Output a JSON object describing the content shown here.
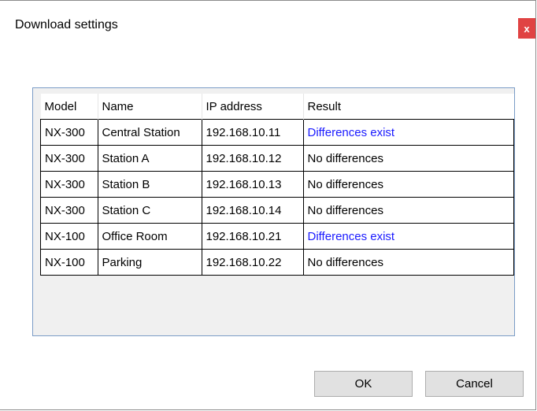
{
  "window": {
    "title": "Download settings",
    "close_label": "x"
  },
  "table": {
    "headers": [
      "Model",
      "Name",
      "IP address",
      "Result"
    ],
    "rows": [
      [
        "NX-300",
        "Central Station",
        "192.168.10.11",
        "Differences exist"
      ],
      [
        "NX-300",
        "Station A",
        "192.168.10.12",
        "No differences"
      ],
      [
        "NX-300",
        "Station B",
        "192.168.10.13",
        "No differences"
      ],
      [
        "NX-300",
        "Station C",
        "192.168.10.14",
        "No differences"
      ],
      [
        "NX-100",
        "Office Room",
        "192.168.10.21",
        "Differences exist"
      ],
      [
        "NX-100",
        "Parking",
        "192.168.10.22",
        "No differences"
      ]
    ]
  },
  "buttons": {
    "ok": "OK",
    "cancel": "Cancel"
  },
  "colors": {
    "difference_text": "#1a1aff",
    "close_button": "#e04343",
    "grid_border": "#7a9cc6"
  }
}
